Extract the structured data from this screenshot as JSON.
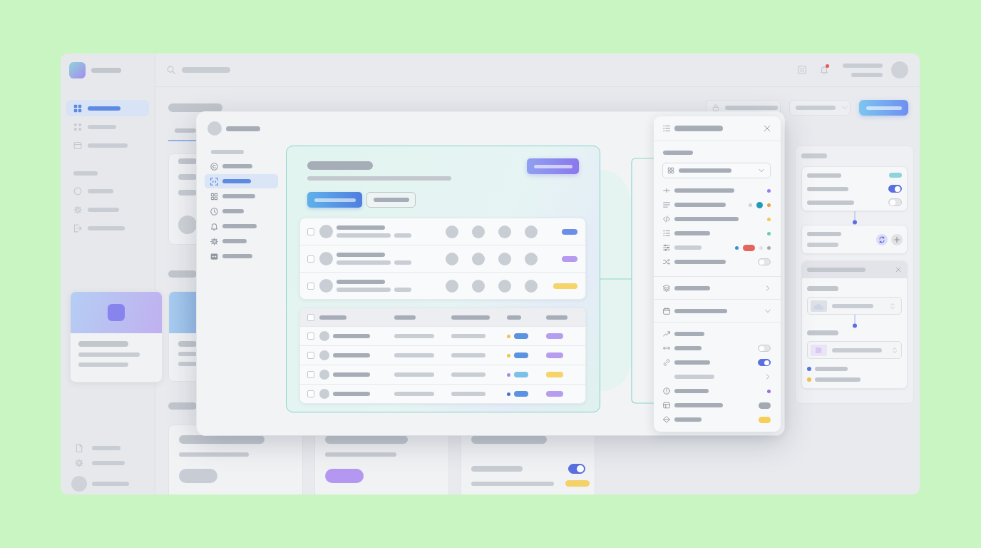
{
  "app": {
    "sidebar": {
      "nav_items": [
        {
          "selected": true
        },
        {
          "selected": false
        },
        {
          "selected": false
        }
      ],
      "section_items": [
        {
          "selected": false
        },
        {
          "selected": false
        },
        {
          "selected": false
        }
      ]
    },
    "topbar": {
      "notifications": {
        "unread": true
      }
    },
    "tabs": [
      {
        "selected": true
      }
    ],
    "bottom_cards": [
      {
        "kind": "action",
        "color": "#c8cdd5"
      },
      {
        "kind": "action",
        "color": "#b497f0"
      },
      {
        "kind": "settings",
        "toggle": {
          "on": true
        },
        "color": "#f3d26a"
      }
    ],
    "right_panel": {
      "settings": [
        {
          "kind": "tag",
          "color": "#8fd3de"
        },
        {
          "kind": "toggle",
          "on": true
        },
        {
          "kind": "toggle",
          "on": false
        }
      ],
      "legend": [
        {
          "color": "#5676dc"
        },
        {
          "color": "#f2c14b"
        }
      ]
    }
  },
  "dialog": {
    "nav_items": [
      {
        "selected": false
      },
      {
        "selected": true
      },
      {
        "selected": false
      },
      {
        "selected": false
      },
      {
        "selected": false
      },
      {
        "selected": false
      },
      {
        "selected": false
      }
    ],
    "member_rows": [
      {
        "checked": false,
        "color": "#6d8ee8"
      },
      {
        "checked": false,
        "color": "#b69af0"
      },
      {
        "checked": false,
        "color": "#f6d46a"
      }
    ],
    "table": {
      "header": {
        "checked": false
      },
      "rows": [
        {
          "checked": false,
          "dot": {
            "color": "#f2c44e"
          },
          "tag": {
            "color": "#5b93e0"
          },
          "pill": {
            "color": "#b79df0"
          }
        },
        {
          "checked": false,
          "dot": {
            "color": "#f2c44e"
          },
          "tag": {
            "color": "#5b93e0"
          },
          "pill": {
            "color": "#b79df0"
          }
        },
        {
          "checked": false,
          "dot": {
            "color": "#a98ae8"
          },
          "tag": {
            "color": "#7cc0e8"
          },
          "pill": {
            "color": "#f6d46a"
          }
        },
        {
          "checked": false,
          "dot": {
            "color": "#4f6fd8"
          },
          "tag": {
            "color": "#5b93e0"
          },
          "pill": {
            "color": "#b79df0"
          }
        }
      ]
    }
  },
  "inspector": {
    "properties": [
      {
        "kind": "marks",
        "marks": [
          {
            "kind": "dot",
            "color": "#9b7be6"
          }
        ]
      },
      {
        "kind": "marks",
        "marks": [
          {
            "kind": "dot",
            "color": "#cfd2d6"
          },
          {
            "kind": "large_dot",
            "color": "#1f9bb8"
          },
          {
            "kind": "dot",
            "color": "#ef9a3c"
          }
        ]
      },
      {
        "kind": "marks",
        "marks": [
          {
            "kind": "dot",
            "color": "#f4c750"
          }
        ]
      },
      {
        "kind": "marks",
        "marks": [
          {
            "kind": "dot",
            "color": "#6cc9b5"
          }
        ]
      },
      {
        "kind": "marks",
        "marks": [
          {
            "kind": "dot",
            "color": "#3d8fcf"
          },
          {
            "kind": "pill",
            "color": "#e4645e"
          },
          {
            "kind": "dot",
            "color": "#dfe1e4"
          },
          {
            "kind": "dot",
            "color": "#a3a9b3"
          }
        ]
      },
      {
        "kind": "toggle",
        "on": false
      }
    ],
    "sections": [
      {
        "expanded": false
      },
      {
        "expanded": true,
        "options": [
          {
            "kind": "plain"
          },
          {
            "kind": "toggle",
            "on": false
          },
          {
            "kind": "toggle",
            "on": true
          },
          {
            "kind": "submenu"
          },
          {
            "kind": "marks",
            "marks": [
              {
                "kind": "dot",
                "color": "#9b6be6"
              }
            ]
          },
          {
            "kind": "marks",
            "marks": [
              {
                "kind": "pill",
                "color": "#a3a9b3"
              }
            ]
          },
          {
            "kind": "marks",
            "marks": [
              {
                "kind": "pill",
                "color": "#f6cf5a"
              }
            ]
          }
        ]
      }
    ]
  }
}
